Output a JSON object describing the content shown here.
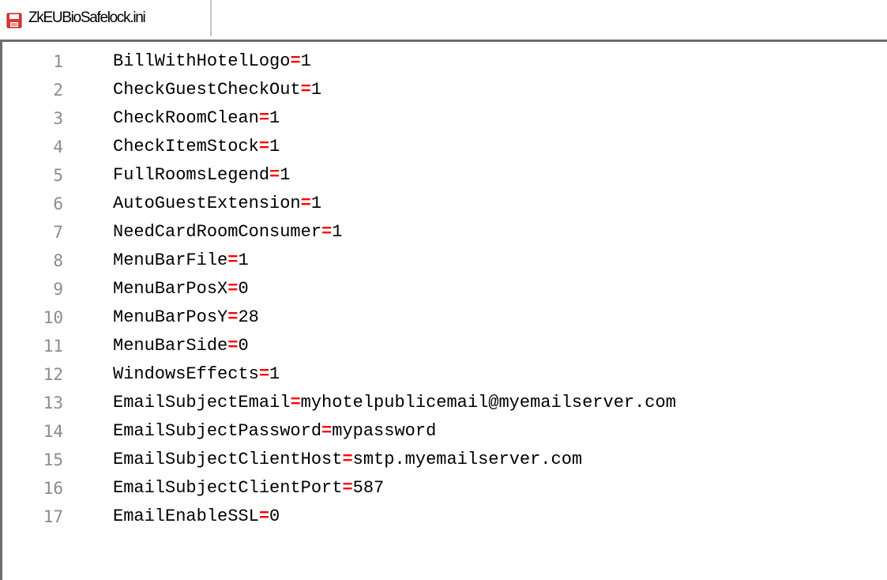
{
  "tab": {
    "filename": "ZkEUBioSafelock.ini",
    "icon": "unsaved-file-icon",
    "icon_color": "#e0342c"
  },
  "editor": {
    "colors": {
      "key": "#000000",
      "operator": "#ff0000",
      "line_number": "#8c8c8c"
    },
    "lines": [
      {
        "num": "1",
        "key": "BillWithHotelLogo",
        "op": "=",
        "value": "1"
      },
      {
        "num": "2",
        "key": "CheckGuestCheckOut",
        "op": "=",
        "value": "1"
      },
      {
        "num": "3",
        "key": "CheckRoomClean",
        "op": "=",
        "value": "1"
      },
      {
        "num": "4",
        "key": "CheckItemStock",
        "op": "=",
        "value": "1"
      },
      {
        "num": "5",
        "key": "FullRoomsLegend",
        "op": "=",
        "value": "1"
      },
      {
        "num": "6",
        "key": "AutoGuestExtension",
        "op": "=",
        "value": "1"
      },
      {
        "num": "7",
        "key": "NeedCardRoomConsumer",
        "op": "=",
        "value": "1"
      },
      {
        "num": "8",
        "key": "MenuBarFile",
        "op": "=",
        "value": "1"
      },
      {
        "num": "9",
        "key": "MenuBarPosX",
        "op": "=",
        "value": "0"
      },
      {
        "num": "10",
        "key": "MenuBarPosY",
        "op": "=",
        "value": "28"
      },
      {
        "num": "11",
        "key": "MenuBarSide",
        "op": "=",
        "value": "0"
      },
      {
        "num": "12",
        "key": "WindowsEffects",
        "op": "=",
        "value": "1"
      },
      {
        "num": "13",
        "key": "EmailSubjectEmail",
        "op": "=",
        "value": "myhotelpublicemail@myemailserver.com"
      },
      {
        "num": "14",
        "key": "EmailSubjectPassword",
        "op": "=",
        "value": "mypassword"
      },
      {
        "num": "15",
        "key": "EmailSubjectClientHost",
        "op": "=",
        "value": "smtp.myemailserver.com"
      },
      {
        "num": "16",
        "key": "EmailSubjectClientPort",
        "op": "=",
        "value": "587"
      },
      {
        "num": "17",
        "key": "EmailEnableSSL",
        "op": "=",
        "value": "0"
      }
    ]
  }
}
